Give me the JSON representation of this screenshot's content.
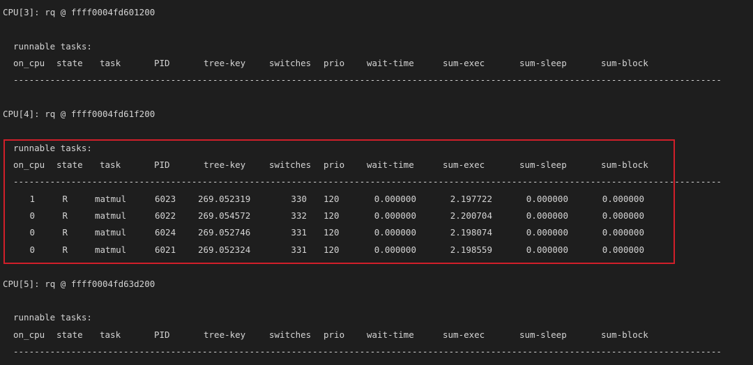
{
  "columns": [
    "on_cpu",
    "state",
    "task",
    "PID",
    "tree-key",
    "switches",
    "prio",
    "wait-time",
    "sum-exec",
    "sum-sleep",
    "sum-block"
  ],
  "runnable_label": "runnable tasks:",
  "dashes": "------------------------------------------------------------------------------------------------------------------------------------------------------------------",
  "cpus": [
    {
      "header": "CPU[3]: rq @ ffff0004fd601200"
    },
    {
      "header": "CPU[4]: rq @ ffff0004fd61f200"
    },
    {
      "header": "CPU[5]: rq @ ffff0004fd63d200"
    }
  ],
  "tasks": [
    {
      "on_cpu": "1",
      "state": "R",
      "task": "matmul",
      "pid": "6023",
      "tree_key": "269.052319",
      "switches": "330",
      "prio": "120",
      "wait_time": "0.000000",
      "sum_exec": "2.197722",
      "sum_sleep": "0.000000",
      "sum_block": "0.000000"
    },
    {
      "on_cpu": "0",
      "state": "R",
      "task": "matmul",
      "pid": "6022",
      "tree_key": "269.054572",
      "switches": "332",
      "prio": "120",
      "wait_time": "0.000000",
      "sum_exec": "2.200704",
      "sum_sleep": "0.000000",
      "sum_block": "0.000000"
    },
    {
      "on_cpu": "0",
      "state": "R",
      "task": "matmul",
      "pid": "6024",
      "tree_key": "269.052746",
      "switches": "331",
      "prio": "120",
      "wait_time": "0.000000",
      "sum_exec": "2.198074",
      "sum_sleep": "0.000000",
      "sum_block": "0.000000"
    },
    {
      "on_cpu": "0",
      "state": "R",
      "task": "matmul",
      "pid": "6021",
      "tree_key": "269.052324",
      "switches": "331",
      "prio": "120",
      "wait_time": "0.000000",
      "sum_exec": "2.198559",
      "sum_sleep": "0.000000",
      "sum_block": "0.000000"
    }
  ],
  "highlight_color": "#d21f2a",
  "background_color": "#1e1e1e",
  "text_color": "#d4d4d4"
}
